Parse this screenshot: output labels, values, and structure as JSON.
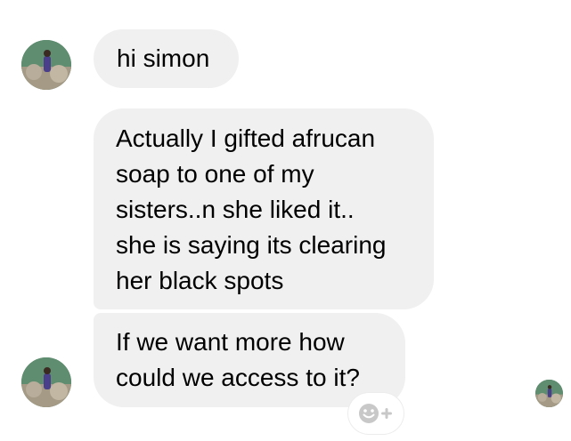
{
  "messages": [
    {
      "text": "hi simon"
    },
    {
      "text": "Actually I gifted afrucan\nsoap to one of my\nsisters..n she liked it..\nshe is saying its clearing\nher black spots"
    },
    {
      "text": "If we want more how\ncould we access to it?"
    }
  ],
  "icons": {
    "avatar": "user-avatar-icon",
    "seen": "read-receipt-avatar-icon",
    "reaction": "add-reaction-icon"
  },
  "colors": {
    "bubble_bg": "#f1f0f0",
    "text": "#000000",
    "reaction_icon": "#c8c8c8"
  }
}
